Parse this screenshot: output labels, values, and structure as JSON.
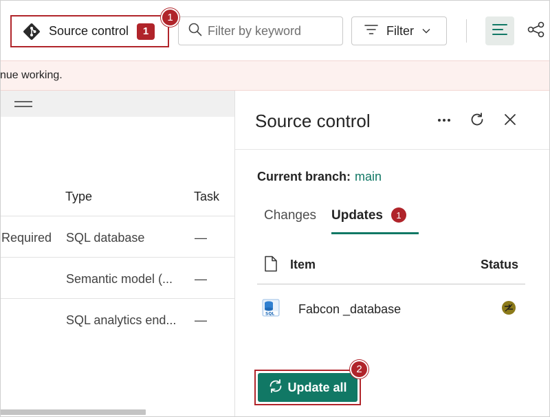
{
  "toolbar": {
    "source_control_label": "Source control",
    "source_control_count": "1",
    "callout_1": "1",
    "search_placeholder": "Filter by keyword",
    "filter_label": "Filter"
  },
  "banner": {
    "text": "nue working."
  },
  "table": {
    "columns": {
      "type": "Type",
      "task": "Task"
    },
    "rows": [
      {
        "status": "Required",
        "type": "SQL database",
        "task": "—"
      },
      {
        "status": "",
        "type": "Semantic model (...",
        "task": "—"
      },
      {
        "status": "",
        "type": "SQL analytics end...",
        "task": "—"
      }
    ]
  },
  "panel": {
    "title": "Source control",
    "branch_label": "Current branch:",
    "branch_value": "main",
    "tabs": [
      {
        "label": "Changes"
      },
      {
        "label": "Updates",
        "badge": "1"
      }
    ],
    "columns": {
      "item": "Item",
      "status": "Status"
    },
    "items": [
      {
        "name": "Fabcon _database"
      }
    ],
    "update_all_label": "Update all",
    "callout_2": "2"
  },
  "colors": {
    "accent": "#117865",
    "callout": "#b0242a",
    "banner_bg": "#fdf1ef",
    "status_icon": "#8c7a1a"
  }
}
